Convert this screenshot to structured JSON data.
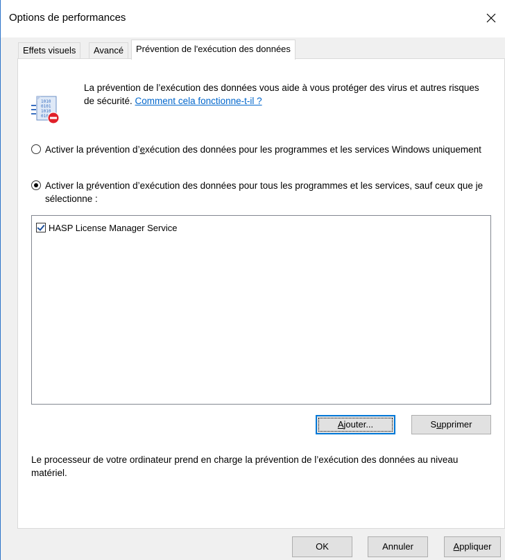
{
  "window": {
    "title": "Options de performances"
  },
  "tabs": [
    {
      "label": "Effets visuels",
      "active": false
    },
    {
      "label": "Avancé",
      "active": false
    },
    {
      "label": "Prévention de l'exécution des données",
      "active": true
    }
  ],
  "intro": {
    "text": "La prévention de l’exécution des données vous aide à vous protéger des virus et autres risques de sécurité. ",
    "link": "Comment cela fonctionne-t-il ?"
  },
  "options": {
    "opt1_pre": "Activer la prévention d’",
    "opt1_key": "e",
    "opt1_post": "xécution des données pour les programmes et les services Windows uniquement",
    "opt1_checked": false,
    "opt2_pre": "Activer la ",
    "opt2_key": "p",
    "opt2_post": "révention d’exécution des données pour tous les programmes et les services, sauf ceux que je sélectionne :",
    "opt2_checked": true
  },
  "list": {
    "items": [
      {
        "label": "HASP License Manager Service",
        "checked": true
      }
    ]
  },
  "buttons": {
    "add_key": "A",
    "add_rest": "jouter...",
    "remove_pre": "S",
    "remove_key": "u",
    "remove_rest": "pprimer",
    "ok": "OK",
    "cancel": "Annuler",
    "apply_key": "A",
    "apply_rest": "ppliquer"
  },
  "hardware_text": "Le processeur de votre ordinateur prend en charge la prévention de l’exécution des données au niveau matériel.",
  "colors": {
    "accent": "#0078d7",
    "link": "#0066cc",
    "window_border": "#2b73c9"
  }
}
